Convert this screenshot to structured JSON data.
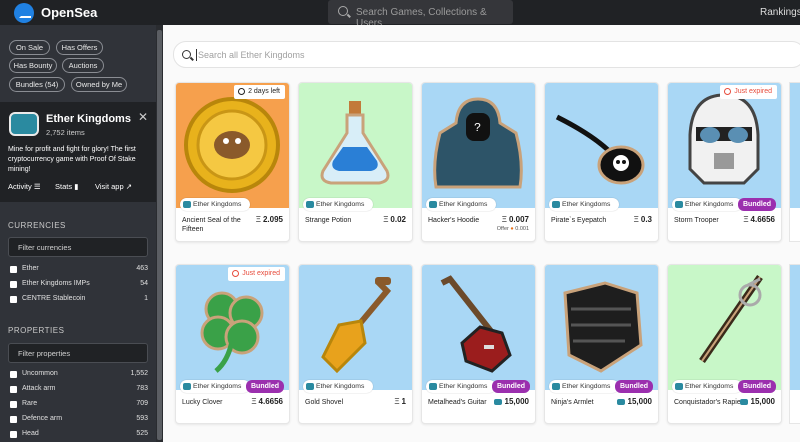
{
  "topbar": {
    "brand": "OpenSea",
    "search_placeholder": "Search Games, Collections & Users",
    "rankings": "Rankings"
  },
  "filters": {
    "pills": [
      "On Sale",
      "Has Offers",
      "Has Bounty",
      "Auctions",
      "Bundles (54)",
      "Owned by Me"
    ]
  },
  "collection": {
    "name": "Ether Kingdoms",
    "count": "2,752 items",
    "description": "Mine for profit and fight for glory! The first cryptocurrency game with Proof Of Stake mining!",
    "links": [
      "Activity",
      "Stats",
      "Visit app"
    ]
  },
  "currencies": {
    "title": "CURRENCIES",
    "filter_placeholder": "Filter currencies",
    "items": [
      {
        "label": "Ether",
        "count": "463"
      },
      {
        "label": "Ether Kingdoms IMPs",
        "count": "54"
      },
      {
        "label": "CENTRE Stablecoin",
        "count": "1"
      }
    ]
  },
  "properties": {
    "title": "PROPERTIES",
    "filter_placeholder": "Filter properties",
    "items": [
      {
        "label": "Uncommon",
        "count": "1,552"
      },
      {
        "label": "Attack arm",
        "count": "783"
      },
      {
        "label": "Rare",
        "count": "709"
      },
      {
        "label": "Defence arm",
        "count": "593"
      },
      {
        "label": "Head",
        "count": "525"
      }
    ]
  },
  "main": {
    "search_placeholder": "Search all Ether Kingdoms"
  },
  "collection_tag": "Ether Kingdoms",
  "bundled_label": "Bundled",
  "eth_symbol": "Ξ",
  "offer_label": "Offer",
  "cards": [
    {
      "name": "Ancient Seal of the Fifteen",
      "price": "2.095",
      "currency": "eth",
      "badge": "2 days left",
      "bg": "#f6a04d",
      "icon": "seal-icon"
    },
    {
      "name": "Strange Potion",
      "price": "0.02",
      "currency": "eth",
      "bg": "#c8f7c8",
      "icon": "potion-icon"
    },
    {
      "name": "Hacker's Hoodie",
      "price": "0.007",
      "currency": "eth",
      "offer": "0.001",
      "bg": "#a9d7f5",
      "icon": "hoodie-icon"
    },
    {
      "name": "Pirate`s Eyepatch",
      "price": "0.3",
      "currency": "eth",
      "bg": "#a9d7f5",
      "icon": "eyepatch-icon"
    },
    {
      "name": "Storm Trooper",
      "price": "4.6656",
      "currency": "eth",
      "badge": "Just expired",
      "badge_expired": true,
      "bundled": true,
      "bg": "#a9d7f5",
      "icon": "trooper-helmet-icon"
    },
    {
      "name": "Lucky Clover",
      "price": "4.6656",
      "currency": "eth",
      "badge": "Just expired",
      "badge_expired": true,
      "bundled": true,
      "bg": "#a9d7f5",
      "icon": "clover-icon"
    },
    {
      "name": "Gold Shovel",
      "price": "1",
      "currency": "eth",
      "bg": "#a9d7f5",
      "icon": "shovel-icon"
    },
    {
      "name": "Metalhead's Guitar",
      "price": "15,000",
      "currency": "token",
      "bundled": true,
      "bg": "#a9d7f5",
      "icon": "guitar-icon"
    },
    {
      "name": "Ninja's Armlet",
      "price": "15,000",
      "currency": "token",
      "bundled": true,
      "bg": "#a9d7f5",
      "icon": "armlet-icon"
    },
    {
      "name": "Conquistador's Rapier",
      "price": "15,000",
      "currency": "token",
      "bundled": true,
      "bg": "#c8f7c8",
      "icon": "rapier-icon"
    }
  ]
}
